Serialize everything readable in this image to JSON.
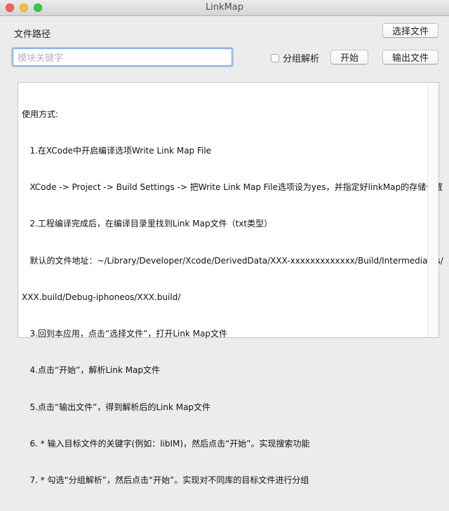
{
  "window": {
    "title": "LinkMap"
  },
  "file_path": {
    "label": "文件路径"
  },
  "buttons": {
    "select_file": "选择文件",
    "start": "开始",
    "export_file": "输出文件"
  },
  "search": {
    "placeholder": "模块关键字",
    "value": ""
  },
  "group_parse": {
    "label": "分组解析",
    "checked": false
  },
  "instructions": {
    "lines": [
      "使用方式:",
      "   1.在XCode中开启编译选项Write Link Map File",
      "   XCode -> Project -> Build Settings -> 把Write Link Map File选项设为yes，并指定好linkMap的存储位置",
      "   2.工程编译完成后，在编译目录里找到Link Map文件（txt类型）",
      "   默认的文件地址：~/Library/Developer/Xcode/DerivedData/XXX-xxxxxxxxxxxxx/Build/Intermediates/",
      "XXX.build/Debug-iphoneos/XXX.build/",
      "   3.回到本应用，点击“选择文件”，打开Link Map文件",
      "   4.点击“开始”，解析Link Map文件",
      "   5.点击“输出文件”，得到解析后的Link Map文件",
      "   6. * 输入目标文件的关键字(例如：libIM)，然后点击“开始”。实现搜索功能",
      "   7. * 勾选“分组解析”，然后点击“开始”。实现对不同库的目标文件进行分组"
    ]
  }
}
